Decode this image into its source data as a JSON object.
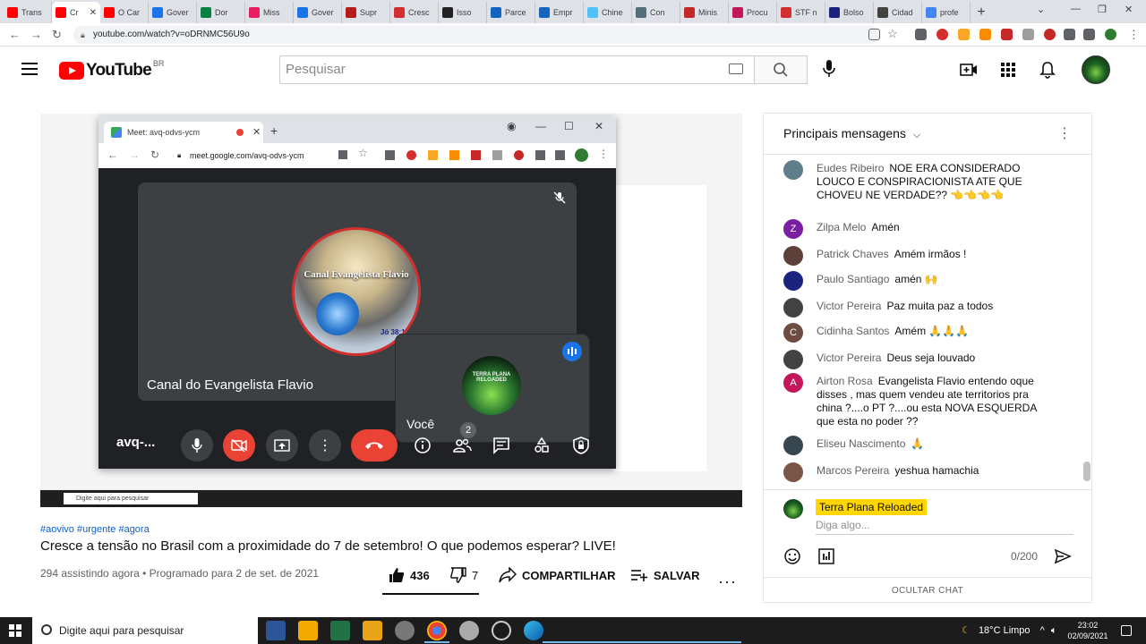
{
  "browser": {
    "tabs": [
      {
        "label": "Trans",
        "color": "#ff0000"
      },
      {
        "label": "Cr",
        "color": "#ff0000",
        "active": true
      },
      {
        "label": "O Car",
        "color": "#ff0000"
      },
      {
        "label": "Gover",
        "color": "#1a73e8"
      },
      {
        "label": "Dor",
        "color": "#0b8043"
      },
      {
        "label": "Miss",
        "color": "#e91e63"
      },
      {
        "label": "Gover",
        "color": "#1a73e8"
      },
      {
        "label": "Supr",
        "color": "#b71c1c"
      },
      {
        "label": "Cresc",
        "color": "#d32f2f"
      },
      {
        "label": "Isso",
        "color": "#212121"
      },
      {
        "label": "Parce",
        "color": "#1565c0"
      },
      {
        "label": "Empr",
        "color": "#1565c0"
      },
      {
        "label": "Chine",
        "color": "#4fc3f7"
      },
      {
        "label": "Con",
        "color": "#546e7a"
      },
      {
        "label": "Minis",
        "color": "#c62828"
      },
      {
        "label": "Procu",
        "color": "#c2185b"
      },
      {
        "label": "STF n",
        "color": "#d32f2f"
      },
      {
        "label": "Bolso",
        "color": "#1a237e"
      },
      {
        "label": "Cidad",
        "color": "#424242"
      },
      {
        "label": "profe",
        "color": "#4285f4"
      }
    ],
    "url": "youtube.com/watch?v=oDRNMC56U9o"
  },
  "youtube": {
    "logo_text": "YouTube",
    "region": "BR",
    "search_placeholder": "Pesquisar"
  },
  "meet": {
    "tab_title": "Meet: avq-odvs-ycm",
    "url": "meet.google.com/avq-odvs-ycm",
    "main_tile_name": "Canal do Evangelista Flavio",
    "logo_caption": "Canal Evangelista Flavio",
    "logo_verse": "Jó 38:14",
    "self_tile_name": "Você",
    "self_avatar_text": "TERRA PLANA RELOADED",
    "meeting_code": "avq-...",
    "people_count": "2"
  },
  "video": {
    "hashtags": "#aovivo #urgente #agora",
    "title": "Cresce a tensão no Brasil com a proximidade do 7 de setembro! O que podemos esperar? LIVE!",
    "meta": "294 assistindo agora • Programado para 2 de set. de 2021",
    "likes": "436",
    "dislikes": "7",
    "share_label": "COMPARTILHAR",
    "save_label": "SALVAR"
  },
  "chat": {
    "title": "Principais mensagens",
    "messages": [
      {
        "author": "Eudes Ribeiro",
        "text": "NOE ERA CONSIDERADO LOUCO E CONSPIRACIONISTA ATE QUE CHOVEU NE VERDADE?? 👈👈👈👈",
        "initial": "",
        "color": "#607d8b"
      },
      {
        "author": "Zilpa Melo",
        "text": "Amén",
        "initial": "Z",
        "color": "#7b1fa2"
      },
      {
        "author": "Patrick Chaves",
        "text": "Amém irmãos !",
        "initial": "",
        "color": "#5d4037"
      },
      {
        "author": "Paulo Santiago",
        "text": "amén 🙌",
        "initial": "",
        "color": "#1a237e"
      },
      {
        "author": "Victor Pereira",
        "text": "Paz muita paz a todos",
        "initial": "",
        "color": "#424242"
      },
      {
        "author": "Cidinha Santos",
        "text": "Amém 🙏🙏🙏",
        "initial": "C",
        "color": "#6d4c41"
      },
      {
        "author": "Victor Pereira",
        "text": "Deus seja louvado",
        "initial": "",
        "color": "#424242"
      },
      {
        "author": "Airton Rosa",
        "text": "Evangelista Flavio entendo oque disses , mas quem vendeu ate territorios pra china ?....o PT ?....ou esta NOVA ESQUERDA que esta no poder ??",
        "initial": "A",
        "color": "#c2185b"
      },
      {
        "author": "Eliseu Nascimento",
        "text": "🙏",
        "initial": "",
        "color": "#37474f"
      },
      {
        "author": "Marcos Pereira",
        "text": "yeshua hamachia",
        "initial": "",
        "color": "#795548"
      }
    ],
    "my_name": "Terra Plana Reloaded",
    "input_placeholder": "Diga algo...",
    "char_count": "0/200",
    "hide_label": "OCULTAR CHAT"
  },
  "taskbar": {
    "search_placeholder": "Digite aqui para pesquisar",
    "weather": "18°C Limpo",
    "time": "23:02",
    "date": "02/09/2021"
  }
}
